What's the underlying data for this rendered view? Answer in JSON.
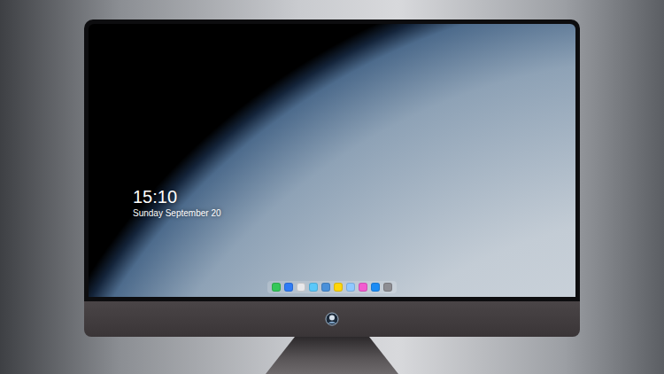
{
  "lock_screen": {
    "time": "15:10",
    "date": "Sunday September 20"
  },
  "dock": {
    "items": [
      {
        "color": "#34c759"
      },
      {
        "color": "#2f7cf6"
      },
      {
        "color": "#e8e8ea"
      },
      {
        "color": "#5ac8fa"
      },
      {
        "color": "#4a90d9"
      },
      {
        "color": "#ffd60a"
      },
      {
        "color": "#8fc8ff"
      },
      {
        "color": "#f25bd0"
      },
      {
        "color": "#1c8cf5"
      },
      {
        "color": "#8e8e93"
      }
    ]
  }
}
